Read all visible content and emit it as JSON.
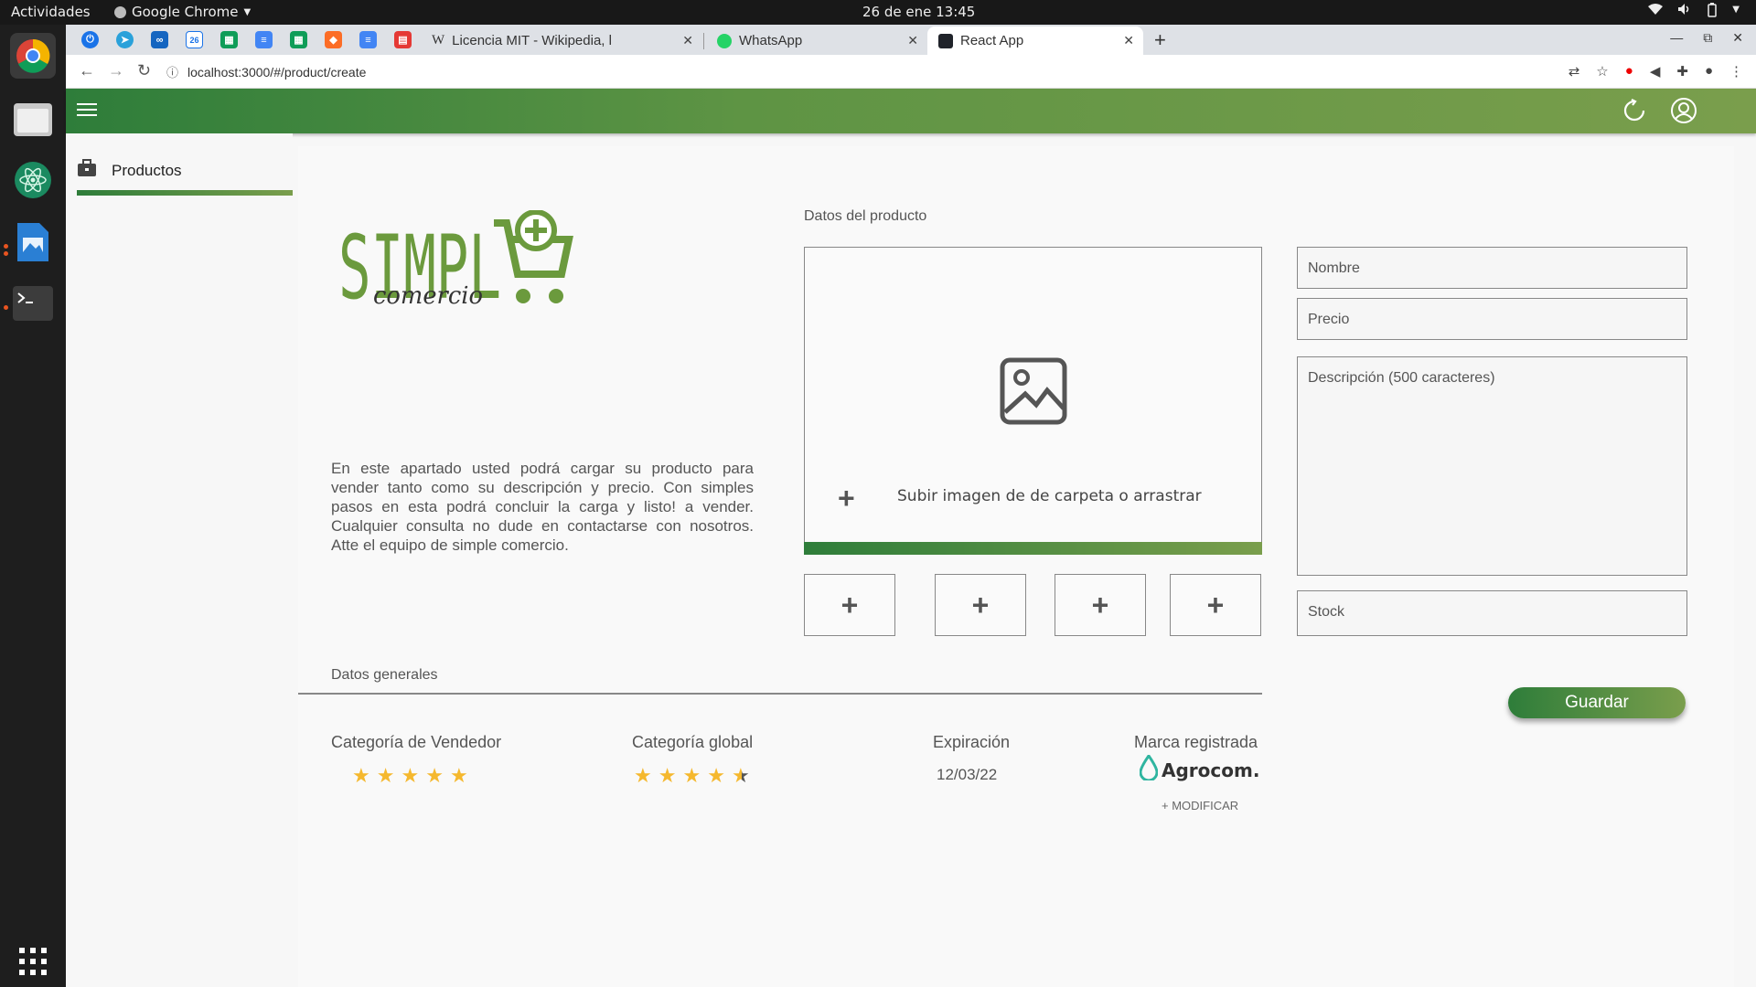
{
  "topbar": {
    "activities": "Actividades",
    "app_name": "Google Chrome",
    "clock": "26 de ene  13:45"
  },
  "browser": {
    "tabs": [
      {
        "label": "Licencia MIT - Wikipedia, l"
      },
      {
        "label": "WhatsApp"
      },
      {
        "label": "React App"
      }
    ],
    "url": "localhost:3000/#/product/create"
  },
  "sidebar": {
    "items": [
      {
        "label": "Productos"
      }
    ]
  },
  "intro": {
    "text": "En este apartado usted podrá cargar su producto para vender tanto como su descripción y precio. Con simples pasos en esta  podrá concluir la carga y listo! a vender. Cualquier consulta no dude en contactarse con nosotros. Atte el equipo de simple comercio."
  },
  "product_form": {
    "section_title": "Datos del producto",
    "upload_label": "Subir imagen de de carpeta  o arrastrar",
    "name_placeholder": "Nombre",
    "price_placeholder": "Precio",
    "description_placeholder": "Descripción (500 caracteres)",
    "stock_placeholder": "Stock",
    "save_label": "Guardar"
  },
  "general": {
    "section_title": "Datos generales",
    "seller_category": {
      "title": "Categoría de Vendedor",
      "rating": 5
    },
    "global_category": {
      "title": "Categoría global",
      "rating": 4.5
    },
    "expiration": {
      "title": "Expiración",
      "value": "12/03/22"
    },
    "brand": {
      "title": "Marca registrada",
      "name": "Agrocom.",
      "modify_label": "+ MODIFICAR"
    }
  },
  "colors": {
    "brand_dark": "#2e7d3a",
    "brand_light": "#7a9e4c",
    "star": "#f5b82e",
    "logo_green": "#6b9a3d"
  }
}
